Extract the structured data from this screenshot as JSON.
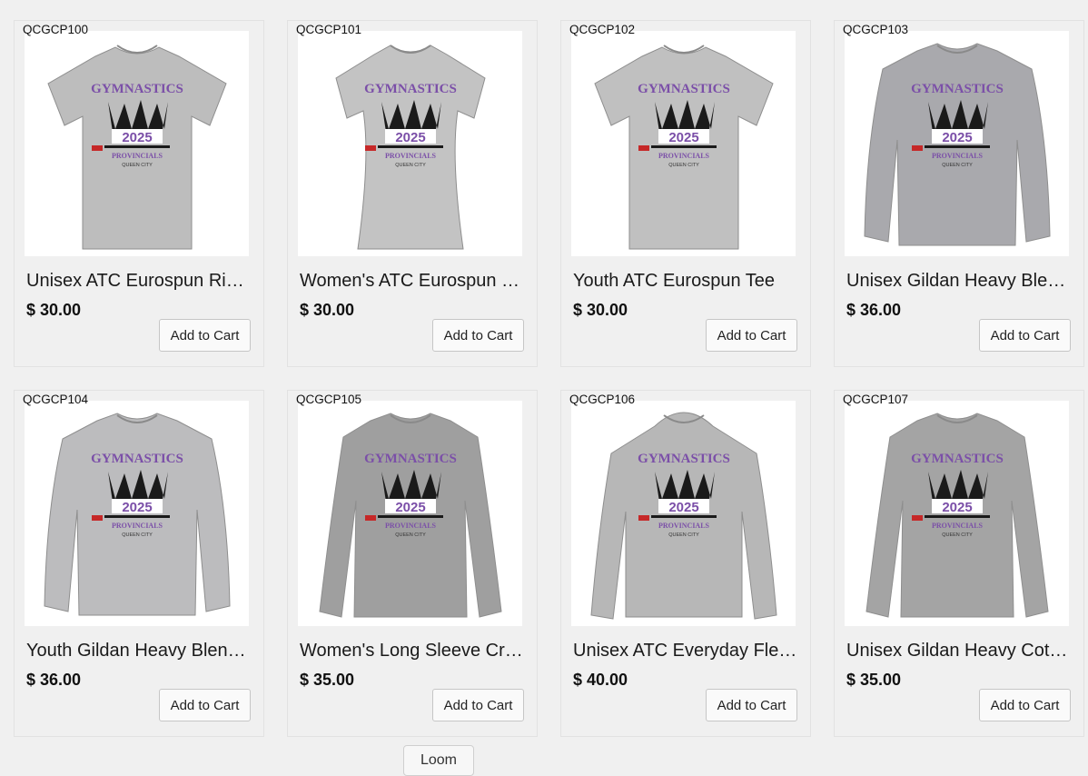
{
  "products": [
    {
      "sku": "QCGCP100",
      "title": "Unisex ATC Eurospun Ri…",
      "price": "$ 30.00",
      "button": "Add to Cart",
      "style": "tee",
      "color": "#bdbdbd"
    },
    {
      "sku": "QCGCP101",
      "title": "Women's ATC Eurospun …",
      "price": "$ 30.00",
      "button": "Add to Cart",
      "style": "ladies-tee",
      "color": "#c3c3c3"
    },
    {
      "sku": "QCGCP102",
      "title": "Youth ATC Eurospun Tee",
      "price": "$ 30.00",
      "button": "Add to Cart",
      "style": "tee",
      "color": "#c0c0c0"
    },
    {
      "sku": "QCGCP103",
      "title": "Unisex Gildan Heavy Ble…",
      "price": "$ 36.00",
      "button": "Add to Cart",
      "style": "crewneck",
      "color": "#a9a9ad"
    },
    {
      "sku": "QCGCP104",
      "title": "Youth Gildan Heavy Blen…",
      "price": "$ 36.00",
      "button": "Add to Cart",
      "style": "crewneck",
      "color": "#bcbcbe"
    },
    {
      "sku": "QCGCP105",
      "title": "Women's Long Sleeve Cr…",
      "price": "$ 35.00",
      "button": "Add to Cart",
      "style": "longsleeve",
      "color": "#9f9f9f"
    },
    {
      "sku": "QCGCP106",
      "title": "Unisex ATC Everyday Fle…",
      "price": "$ 40.00",
      "button": "Add to Cart",
      "style": "hoodie",
      "color": "#b7b7b7"
    },
    {
      "sku": "QCGCP107",
      "title": "Unisex Gildan Heavy Cot…",
      "price": "$ 35.00",
      "button": "Add to Cart",
      "style": "longsleeve",
      "color": "#a4a4a4"
    }
  ],
  "print": {
    "top": "GYMNASTICS",
    "year": "2025",
    "line1": "PROVINCIALS",
    "line2": "QUEEN CITY",
    "purple": "#7b4fa8"
  },
  "loom_button": "Loom"
}
